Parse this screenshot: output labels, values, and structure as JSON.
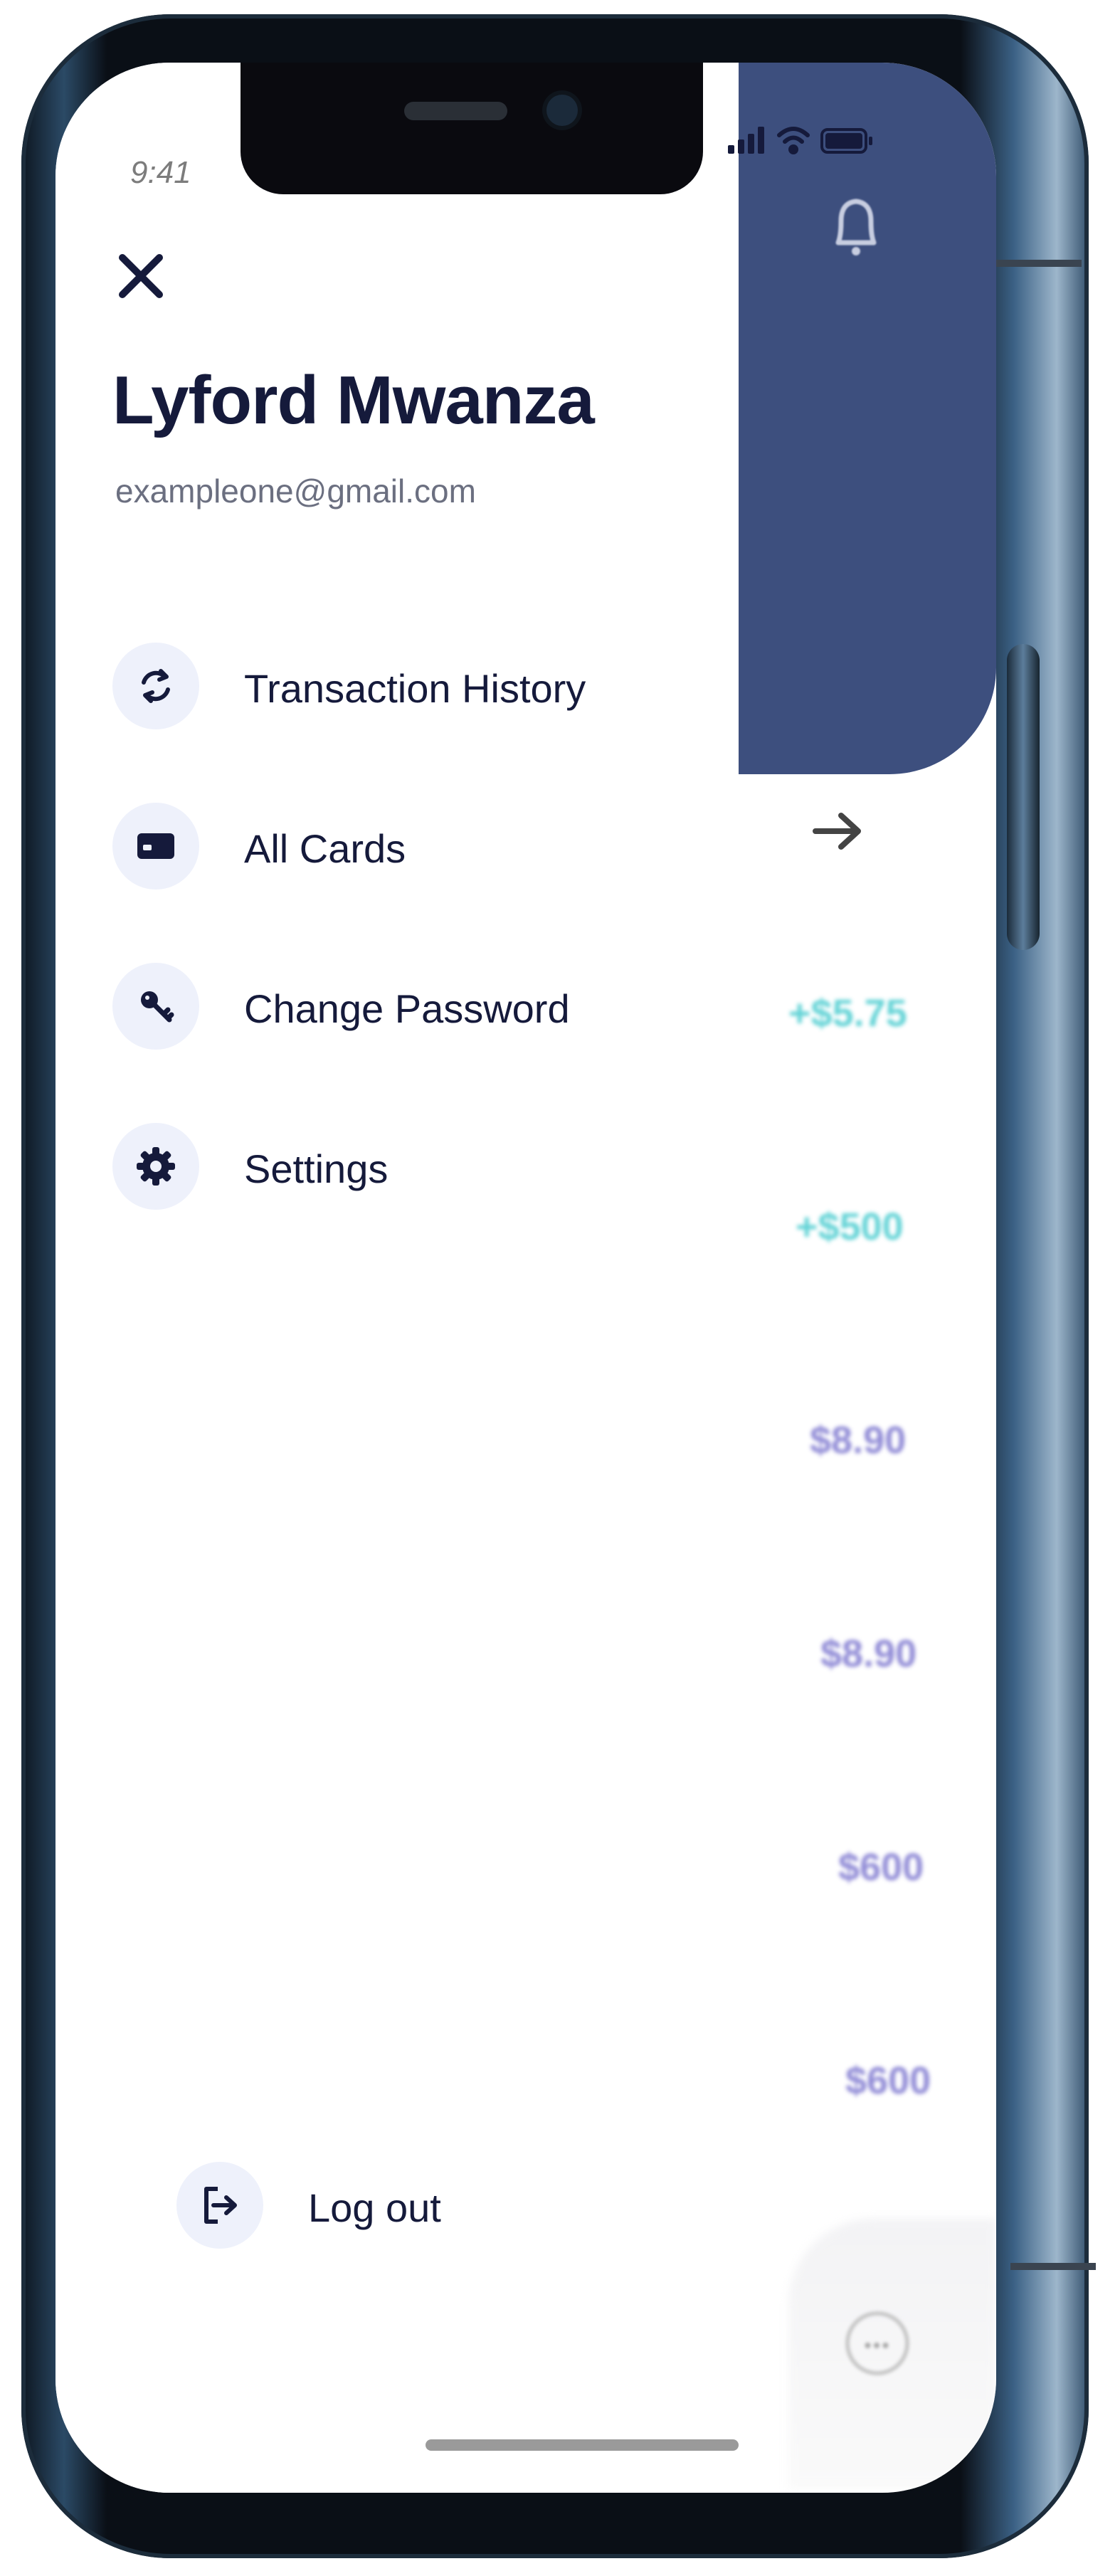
{
  "status_bar": {
    "time": "9:41"
  },
  "drawer": {
    "user_name": "Lyford Mwanza",
    "user_email": "exampleone@gmail.com",
    "menu_items": [
      {
        "label": "Transaction History",
        "icon": "refresh-icon"
      },
      {
        "label": "All Cards",
        "icon": "card-icon"
      },
      {
        "label": "Change Password",
        "icon": "key-icon"
      },
      {
        "label": "Settings",
        "icon": "gear-icon"
      }
    ],
    "logout_label": "Log out"
  },
  "background_app": {
    "amounts": [
      {
        "text": "+$5.75",
        "color": "#2ec4c8"
      },
      {
        "text": "+$500",
        "color": "#2ec4c8"
      },
      {
        "text": "$8.90",
        "color": "#6a63c8"
      },
      {
        "text": "$8.90",
        "color": "#6a63c8"
      },
      {
        "text": "$600",
        "color": "#6a63c8"
      },
      {
        "text": "$600",
        "color": "#6a63c8"
      }
    ],
    "fab_icon": "more-dots-icon",
    "bell_icon": "bell-icon"
  },
  "colors": {
    "header": "#3d4f7e",
    "text_dark": "#151a3b",
    "icon_bg": "#eef1fb"
  }
}
